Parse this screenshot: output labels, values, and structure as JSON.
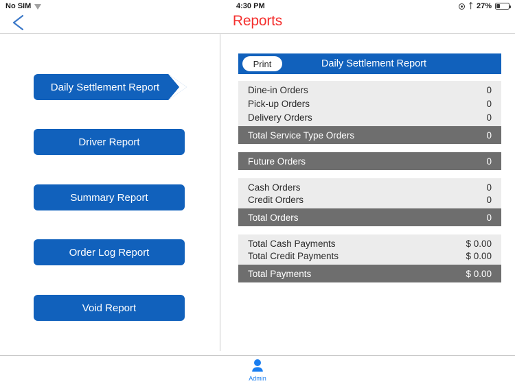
{
  "status_bar": {
    "carrier": "No SIM",
    "wifi_icon": "wifi-icon",
    "time": "4:30 PM",
    "location_icon": "location-services-icon",
    "bluetooth_icon": "bluetooth-icon",
    "battery_percent": "27%",
    "battery_icon": "battery-icon"
  },
  "nav_bar": {
    "title": "Reports",
    "title_color": "#f4302e",
    "back_icon": "back-chevron-icon"
  },
  "sidebar": {
    "accent_color": "#1161BC",
    "items": [
      {
        "label": "Daily Settlement Report",
        "selected": true
      },
      {
        "label": "Driver Report",
        "selected": false
      },
      {
        "label": "Summary Report",
        "selected": false
      },
      {
        "label": "Order Log Report",
        "selected": false
      },
      {
        "label": "Void Report",
        "selected": false
      }
    ]
  },
  "report": {
    "header": {
      "print_label": "Print",
      "title": "Daily Settlement Report",
      "background_color": "#1161BC"
    },
    "row_color": "#ececec",
    "total_color": "#6e6e6e",
    "groups": [
      {
        "rows": [
          {
            "label": "Dine-in Orders",
            "value": "0",
            "type": "normal"
          },
          {
            "label": "Pick-up Orders",
            "value": "0",
            "type": "normal"
          },
          {
            "label": "Delivery Orders",
            "value": "0",
            "type": "normal"
          },
          {
            "label": "Total Service Type Orders",
            "value": "0",
            "type": "total"
          }
        ]
      },
      {
        "rows": [
          {
            "label": "Future Orders",
            "value": "0",
            "type": "total"
          }
        ]
      },
      {
        "rows": [
          {
            "label": "Cash Orders",
            "value": "0",
            "type": "normal"
          },
          {
            "label": "Credit Orders",
            "value": "0",
            "type": "normal"
          },
          {
            "label": "Total Orders",
            "value": "0",
            "type": "total"
          }
        ]
      },
      {
        "rows": [
          {
            "label": "Total Cash Payments",
            "value": "$ 0.00",
            "type": "normal"
          },
          {
            "label": "Total Credit Payments",
            "value": "$ 0.00",
            "type": "normal"
          },
          {
            "label": "Total Payments",
            "value": "$ 0.00",
            "type": "total"
          }
        ]
      }
    ]
  },
  "tab_bar": {
    "items": [
      {
        "label": "Admin",
        "icon": "person-icon",
        "color": "#1a7ef0"
      }
    ]
  }
}
